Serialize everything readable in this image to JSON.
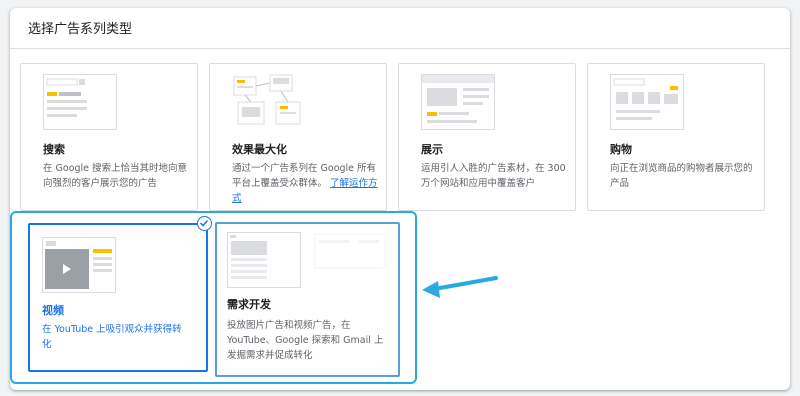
{
  "header": {
    "title": "选择广告系列类型"
  },
  "cards": {
    "search": {
      "title": "搜索",
      "desc": "在 Google 搜索上恰当其时地向意向强烈的客户展示您的广告"
    },
    "pmax": {
      "title": "效果最大化",
      "desc": "通过一个广告系列在 Google 所有平台上覆盖受众群体。",
      "link": "了解运作方式"
    },
    "display": {
      "title": "展示",
      "desc": "运用引人入胜的广告素材，在 300 万个网站和应用中覆盖客户"
    },
    "shopping": {
      "title": "购物",
      "desc": "向正在浏览商品的购物者展示您的产品"
    },
    "video": {
      "title": "视频",
      "desc": "在 YouTube 上吸引观众并获得转化",
      "selected": true
    },
    "demandgen": {
      "title": "需求开发",
      "desc": "投放图片广告和视频广告，在 YouTube、Google 探索和 Gmail 上发掘需求并促成转化"
    }
  },
  "colors": {
    "accent": "#1a73e8",
    "highlight": "#29a9e1",
    "yellow": "#fbbc04"
  },
  "icons": [
    "check-icon",
    "arrow-annotation"
  ]
}
